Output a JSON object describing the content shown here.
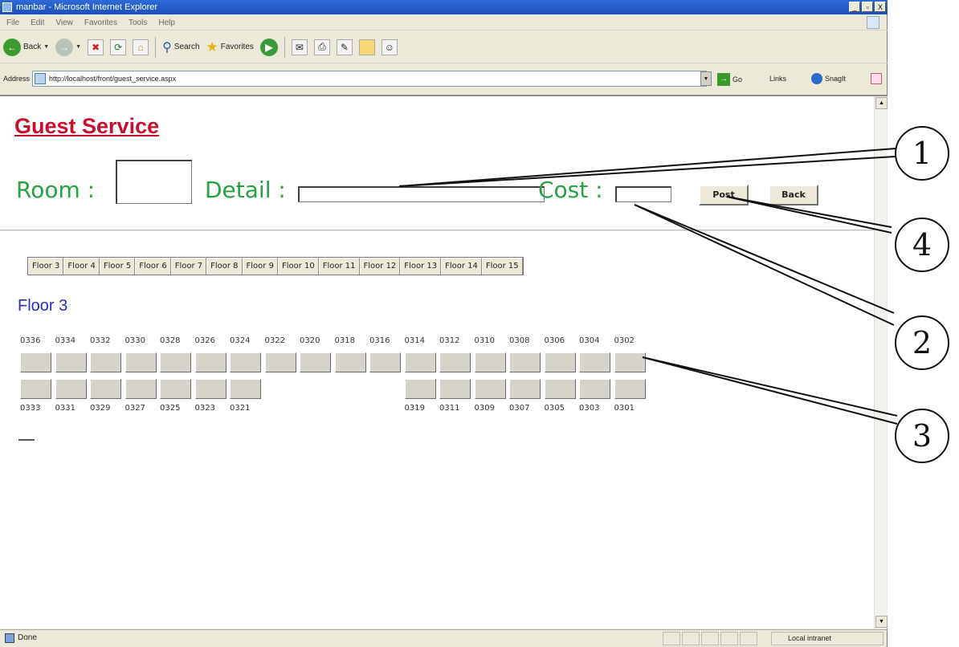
{
  "window": {
    "title": "manbar - Microsoft Internet Explorer",
    "controls": [
      "_",
      "▫",
      "X"
    ]
  },
  "menubar": [
    "File",
    "Edit",
    "View",
    "Favorites",
    "Tools",
    "Help"
  ],
  "toolbar": {
    "back": "Back",
    "search": "Search",
    "favorites": "Favorites"
  },
  "addressbar": {
    "label": "Address",
    "url": "http://localhost/front/guest_service.aspx",
    "go": "Go",
    "links": "Links",
    "snagit": "SnagIt"
  },
  "page": {
    "title": "Guest Service",
    "room_label": "Room :",
    "detail_label": "Detail :",
    "cost_label": "Cost :",
    "room_value": "",
    "detail_value": "",
    "cost_value": "",
    "post_button": "Post",
    "back_button": "Back",
    "floor_tabs": [
      "Floor 3",
      "Floor 4",
      "Floor 5",
      "Floor 6",
      "Floor 7",
      "Floor 8",
      "Floor 9",
      "Floor 10",
      "Floor 11",
      "Floor 12",
      "Floor 13",
      "Floor 14",
      "Floor 15"
    ],
    "floor_heading": "Floor 3",
    "top_rooms": [
      "0336",
      "0334",
      "0332",
      "0330",
      "0328",
      "0326",
      "0324",
      "0322",
      "0320",
      "0318",
      "0316",
      "0314",
      "0312",
      "0310",
      "0308",
      "0306",
      "0304",
      "0302"
    ],
    "bottom_rooms_left": [
      "0333",
      "0331",
      "0329",
      "0327",
      "0325",
      "0323",
      "0321"
    ],
    "bottom_rooms_right": [
      "0319",
      "0311",
      "0309",
      "0307",
      "0305",
      "0303",
      "0301"
    ]
  },
  "statusbar": {
    "status": "Done",
    "zone": "Local intranet"
  },
  "callouts": [
    "1",
    "4",
    "2",
    "3"
  ]
}
